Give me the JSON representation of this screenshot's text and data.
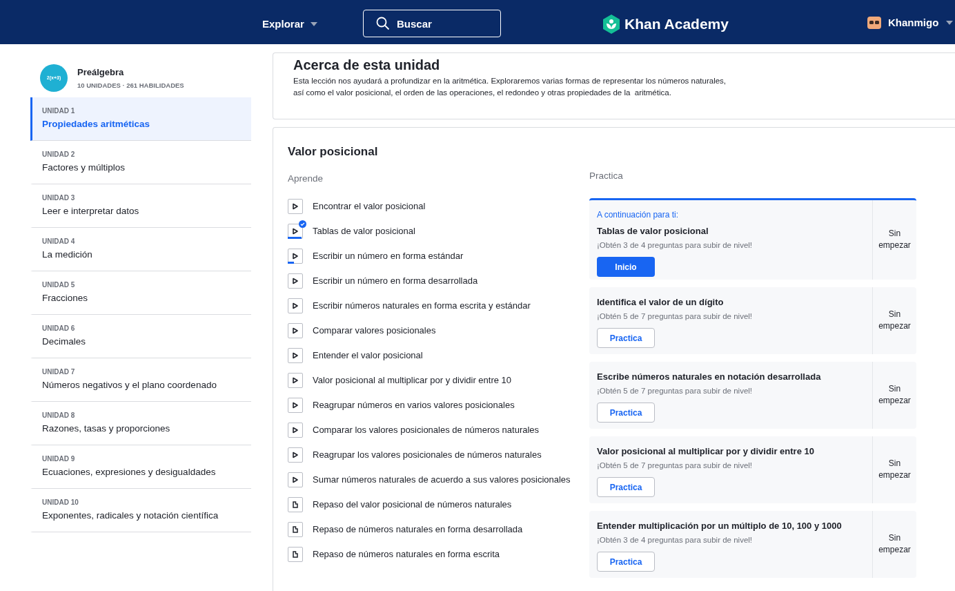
{
  "header": {
    "explore": "Explorar",
    "search": {
      "placeholder": "Buscar"
    },
    "brand": "Khan Academy",
    "user": "Khanmigo"
  },
  "sidebar": {
    "course": {
      "icon_text": "2(x+3)",
      "title": "Preálgebra",
      "meta": "10 UNIDADES · 261 HABILIDADES"
    },
    "units": [
      {
        "label": "UNIDAD 1",
        "title": "Propiedades aritméticas",
        "selected": true
      },
      {
        "label": "UNIDAD 2",
        "title": "Factores y múltiplos",
        "selected": false
      },
      {
        "label": "UNIDAD 3",
        "title": "Leer e interpretar datos",
        "selected": false
      },
      {
        "label": "UNIDAD 4",
        "title": "La medición",
        "selected": false
      },
      {
        "label": "UNIDAD 5",
        "title": "Fracciones",
        "selected": false
      },
      {
        "label": "UNIDAD 6",
        "title": "Decimales",
        "selected": false
      },
      {
        "label": "UNIDAD 7",
        "title": "Números negativos y el plano coordenado",
        "selected": false
      },
      {
        "label": "UNIDAD 8",
        "title": "Razones, tasas y proporciones",
        "selected": false
      },
      {
        "label": "UNIDAD 9",
        "title": "Ecuaciones, expresiones y desigualdades",
        "selected": false
      },
      {
        "label": "UNIDAD 10",
        "title": "Exponentes, radicales y notación científica",
        "selected": false
      }
    ]
  },
  "about": {
    "title": "Acerca de esta unidad",
    "text_lines": [
      "Esta lección nos ayudará a profundizar en la aritmética. Exploraremos varias formas de representar los números naturales,",
      "así como el valor posicional, el orden de las operaciones, el redondeo y otras propiedades de la  aritmética."
    ]
  },
  "lesson": {
    "title": "Valor posicional",
    "learn_heading": "Aprende",
    "practice_heading": "Practica",
    "items": [
      {
        "kind": "video",
        "title": "Encontrar el valor posicional",
        "completed": false,
        "level": 0
      },
      {
        "kind": "video",
        "title": "Tablas de valor posicional",
        "completed": true,
        "level": 1
      },
      {
        "kind": "video",
        "title": "Escribir un número en forma estándar",
        "completed": false,
        "level": 0.45
      },
      {
        "kind": "video",
        "title": "Escribir un número en forma desarrollada",
        "completed": false,
        "level": 0
      },
      {
        "kind": "video",
        "title": "Escribir números naturales en forma escrita y estándar",
        "completed": false,
        "level": 0
      },
      {
        "kind": "video",
        "title": "Comparar valores posicionales",
        "completed": false,
        "level": 0
      },
      {
        "kind": "video",
        "title": "Entender el valor posicional",
        "completed": false,
        "level": 0
      },
      {
        "kind": "video",
        "title": "Valor posicional al multiplicar por y dividir entre 10",
        "completed": false,
        "level": 0
      },
      {
        "kind": "video",
        "title": "Reagrupar números en varios valores posicionales",
        "completed": false,
        "level": 0
      },
      {
        "kind": "video",
        "title": "Comparar los valores posicionales de números naturales",
        "completed": false,
        "level": 0
      },
      {
        "kind": "video",
        "title": "Reagrupar los valores posicionales de números naturales",
        "completed": false,
        "level": 0
      },
      {
        "kind": "video",
        "title": "Sumar números naturales de acuerdo a sus valores posicionales",
        "completed": false,
        "level": 0
      },
      {
        "kind": "article",
        "title": "Repaso del valor posicional de números naturales",
        "completed": false
      },
      {
        "kind": "article",
        "title": "Repaso de números naturales en forma desarrollada",
        "completed": false
      },
      {
        "kind": "article",
        "title": "Repaso de números naturales en forma escrita",
        "completed": false
      }
    ],
    "practice": [
      {
        "highlighted": true,
        "kicker": "A continuación para ti:",
        "title": "Tablas de valor posicional",
        "hint": "¡Obtén 3 de 4 preguntas para subir de nivel!",
        "button": "Inicio",
        "status": "Sin empezar"
      },
      {
        "highlighted": false,
        "title": "Identifica el valor de un dígito",
        "hint": "¡Obtén 5 de 7 preguntas para subir de nivel!",
        "button": "Practica",
        "status": "Sin empezar"
      },
      {
        "highlighted": false,
        "title": "Escribe números naturales en notación desarrollada",
        "hint": "¡Obtén 5 de 7 preguntas para subir de nivel!",
        "button": "Practica",
        "status": "Sin empezar"
      },
      {
        "highlighted": false,
        "title": "Valor posicional al multiplicar por y dividir entre 10",
        "hint": "¡Obtén 5 de 7 preguntas para subir de nivel!",
        "button": "Practica",
        "status": "Sin empezar"
      },
      {
        "highlighted": false,
        "title": "Entender multiplicación por un múltiplo de 10, 100 y 1000",
        "hint": "¡Obtén 3 de 4 preguntas para subir de nivel!",
        "button": "Practica",
        "status": "Sin empezar"
      }
    ]
  }
}
